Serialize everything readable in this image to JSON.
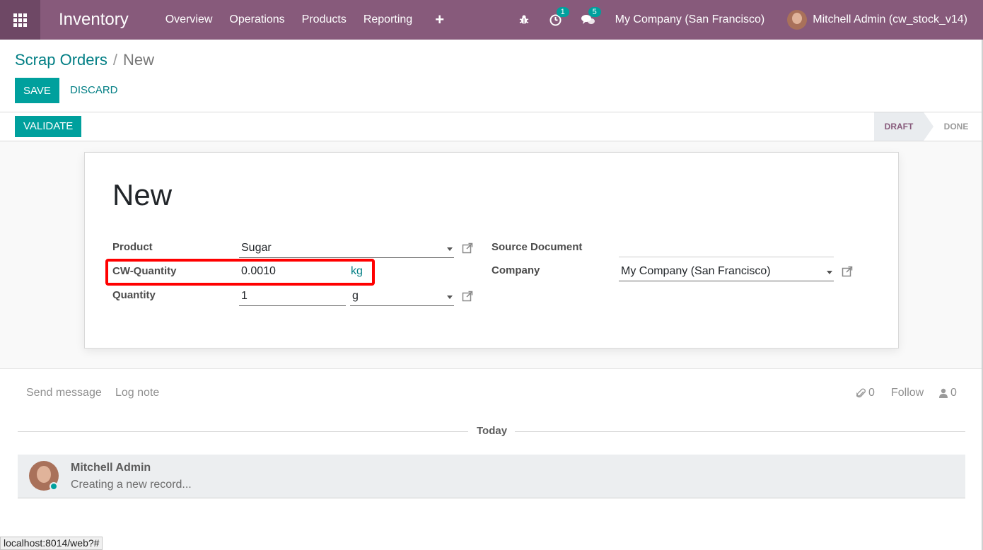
{
  "navbar": {
    "app_name": "Inventory",
    "menu": [
      "Overview",
      "Operations",
      "Products",
      "Reporting"
    ],
    "plus": "+",
    "activity_count": "1",
    "messages_count": "5",
    "company": "My Company (San Francisco)",
    "user": "Mitchell Admin (cw_stock_v14)"
  },
  "breadcrumb": {
    "parent": "Scrap Orders",
    "separator": "/",
    "current": "New"
  },
  "buttons": {
    "save": "SAVE",
    "discard": "DISCARD",
    "validate": "VALIDATE"
  },
  "statusbar": {
    "stages": [
      "DRAFT",
      "DONE"
    ],
    "active": "DRAFT"
  },
  "form": {
    "title": "New",
    "product_label": "Product",
    "product_value": "Sugar",
    "cw_quantity_label": "CW-Quantity",
    "cw_quantity_value": "0.0010",
    "cw_quantity_unit": "kg",
    "quantity_label": "Quantity",
    "quantity_value": "1",
    "quantity_uom": "g",
    "source_document_label": "Source Document",
    "source_document_value": "",
    "company_label": "Company",
    "company_value": "My Company (San Francisco)"
  },
  "chatter": {
    "send_message": "Send message",
    "log_note": "Log note",
    "attachments_count": "0",
    "follow": "Follow",
    "followers_count": "0",
    "date_divider": "Today",
    "messages": [
      {
        "author": "Mitchell Admin",
        "body": "Creating a new record..."
      }
    ]
  },
  "status_url": "localhost:8014/web?#",
  "colors": {
    "navbar": "#875a7b",
    "primary": "#00a09d",
    "link": "#017e84",
    "highlight_box": "#ff0000"
  }
}
